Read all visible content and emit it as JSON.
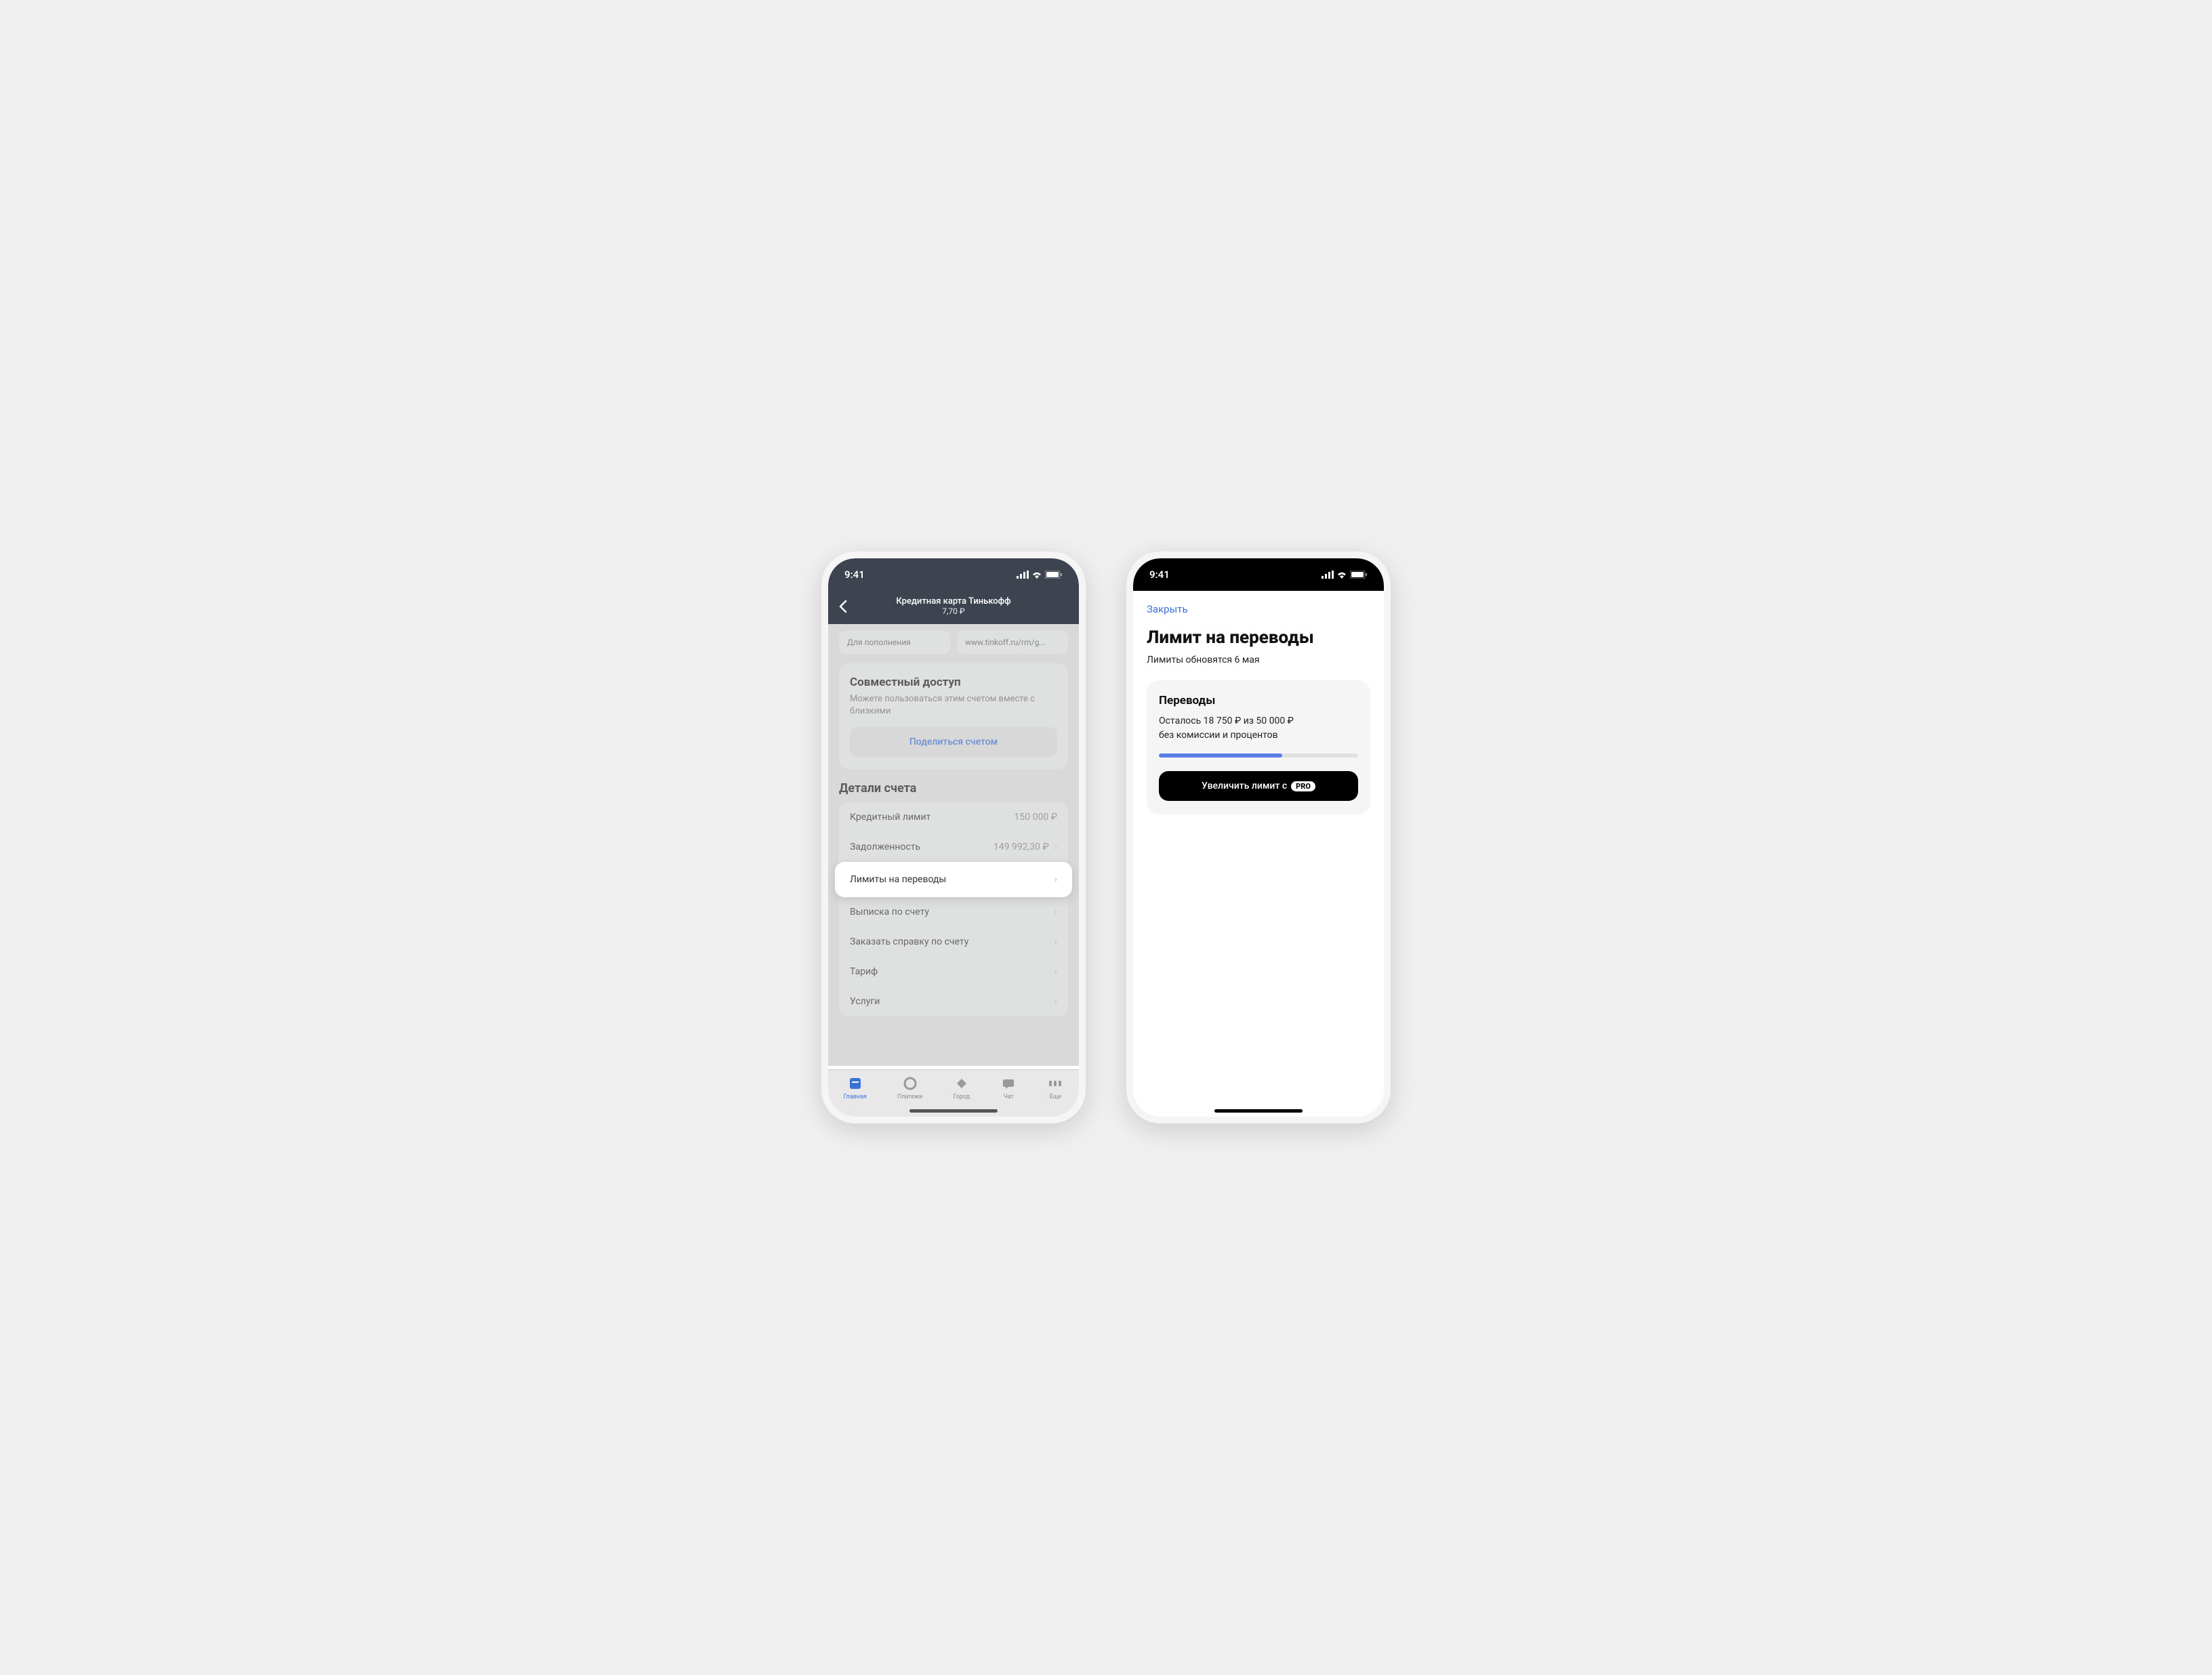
{
  "status": {
    "time": "9:41"
  },
  "left": {
    "nav": {
      "title": "Кредитная карта Тинькофф",
      "subtitle": "7,70 ₽"
    },
    "pills": {
      "deposit": "Для пополнения",
      "link": "www.tinkoff.ru/rm/g..."
    },
    "shared": {
      "title": "Совместный доступ",
      "desc": "Можете пользоваться этим счетом вместе с близкими",
      "button": "Поделиться счетом"
    },
    "details": {
      "heading": "Детали счета",
      "rows": [
        {
          "label": "Кредитный лимит",
          "value": "150 000 ₽",
          "chevron": false
        },
        {
          "label": "Задолженность",
          "value": "149 992,30 ₽",
          "chevron": true
        },
        {
          "label": "Лимиты на переводы",
          "value": "",
          "chevron": true,
          "highlighted": true
        },
        {
          "label": "Выписка по счету",
          "value": "",
          "chevron": true
        },
        {
          "label": "Заказать справку по счету",
          "value": "",
          "chevron": true
        },
        {
          "label": "Тариф",
          "value": "",
          "chevron": true
        },
        {
          "label": "Услуги",
          "value": "",
          "chevron": true
        }
      ]
    },
    "tabs": [
      {
        "label": "Главная",
        "icon": "home",
        "active": true
      },
      {
        "label": "Платежи",
        "icon": "payments",
        "active": false
      },
      {
        "label": "Город",
        "icon": "city",
        "active": false
      },
      {
        "label": "Чат",
        "icon": "chat",
        "active": false
      },
      {
        "label": "Еще",
        "icon": "more",
        "active": false
      }
    ]
  },
  "right": {
    "close": "Закрыть",
    "title": "Лимит на переводы",
    "subtitle": "Лимиты обновятся 6 мая",
    "card": {
      "title": "Переводы",
      "line1": "Осталось 18 750 ₽ из 50 000 ₽",
      "line2": "без комиссии и процентов",
      "progress_percent": 62,
      "button_text": "Увеличить лимит с",
      "pro_badge": "PRO"
    }
  }
}
